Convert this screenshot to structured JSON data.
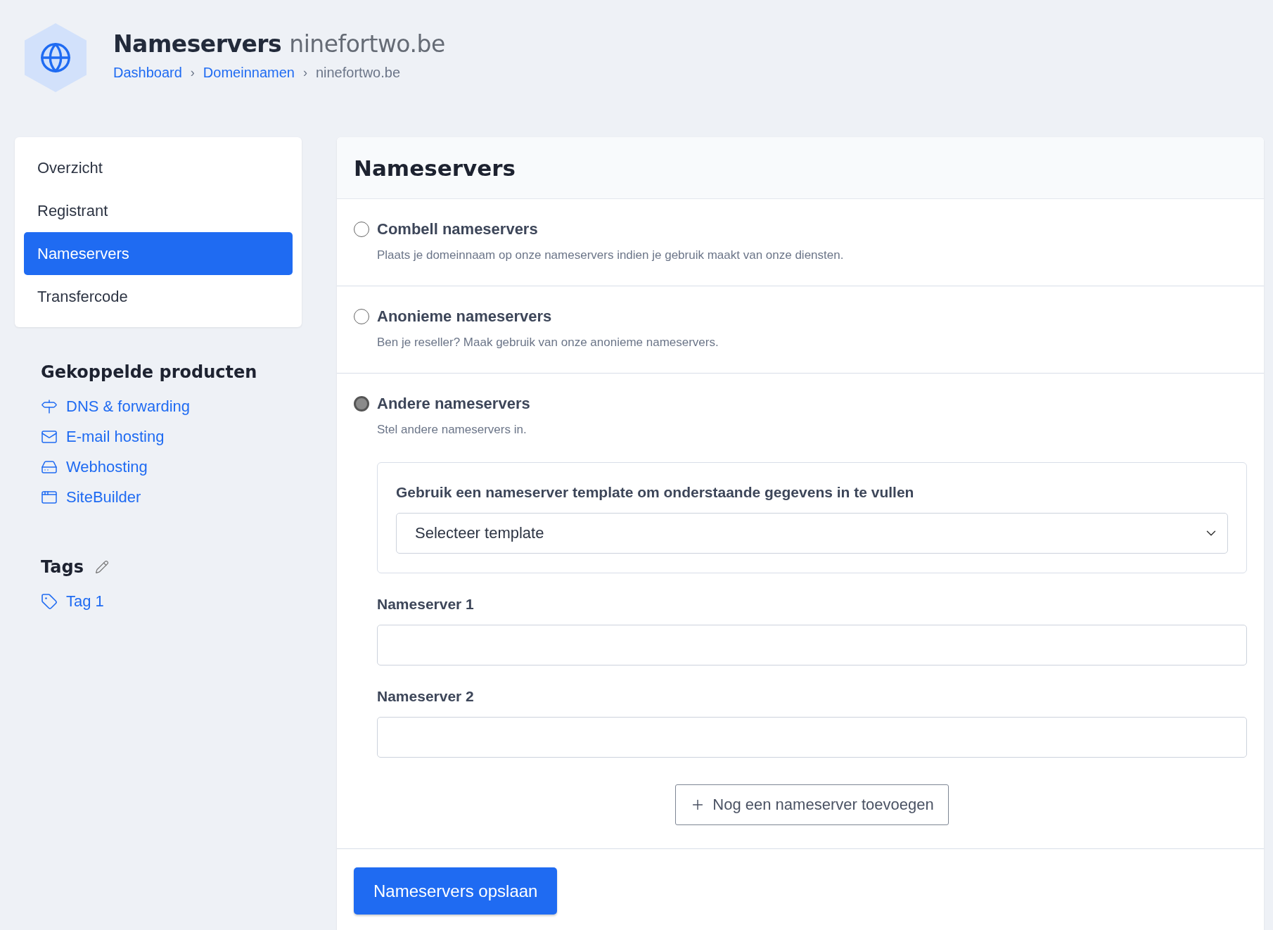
{
  "header": {
    "title": "Nameservers",
    "domain": "ninefortwo.be",
    "breadcrumbs": [
      {
        "label": "Dashboard",
        "link": true
      },
      {
        "label": "Domeinnamen",
        "link": true
      },
      {
        "label": "ninefortwo.be",
        "link": false
      }
    ],
    "separator": "›"
  },
  "sidebar": {
    "items": [
      {
        "label": "Overzicht",
        "selected": false
      },
      {
        "label": "Registrant",
        "selected": false
      },
      {
        "label": "Nameservers",
        "selected": true
      },
      {
        "label": "Transfercode",
        "selected": false
      }
    ]
  },
  "linked_products": {
    "title": "Gekoppelde producten",
    "items": [
      {
        "label": "DNS & forwarding",
        "kind": "dns"
      },
      {
        "label": "E-mail hosting",
        "kind": "mail"
      },
      {
        "label": "Webhosting",
        "kind": "hosting"
      },
      {
        "label": "SiteBuilder",
        "kind": "sitebuilder"
      }
    ]
  },
  "tags": {
    "title": "Tags",
    "items": [
      "Tag 1"
    ]
  },
  "panel": {
    "title": "Nameservers",
    "options": [
      {
        "title": "Combell nameservers",
        "description": "Plaats je domeinnaam op onze nameservers indien je gebruik maakt van onze diensten.",
        "selected": false
      },
      {
        "title": "Anonieme nameservers",
        "description": "Ben je reseller? Maak gebruik van onze anonieme nameservers.",
        "selected": false
      },
      {
        "title": "Andere nameservers",
        "description": "Stel andere nameservers in.",
        "selected": true,
        "form": {
          "template_label": "Gebruik een nameserver template om onderstaande gegevens in te vullen",
          "template_value": "Selecteer template",
          "fields": [
            {
              "label": "Nameserver 1"
            },
            {
              "label": "Nameserver 2"
            }
          ],
          "add_button": "Nog een nameserver toevoegen"
        }
      }
    ],
    "save_button": "Nameservers opslaan"
  }
}
